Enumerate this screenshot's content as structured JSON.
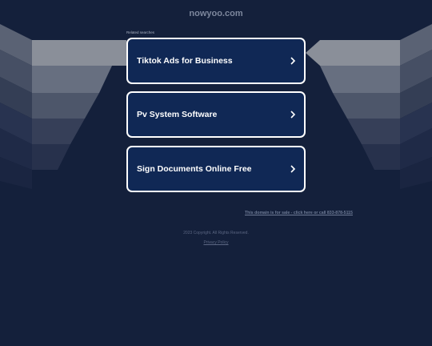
{
  "header": {
    "domain": "nowyoo.com"
  },
  "related": {
    "label": "Related searches",
    "items": [
      {
        "label": "Tiktok Ads for Business"
      },
      {
        "label": "Pv System Software"
      },
      {
        "label": "Sign Documents Online Free"
      }
    ]
  },
  "footer": {
    "for_sale": "This domain is for sale - click here or call 833-878-5115",
    "copyright": "2023 Copyright. All Rights Reserved.",
    "privacy": "Privacy Policy"
  },
  "colors": {
    "background": "#14203b",
    "box": "#102855",
    "box_border": "#ffffff",
    "text_muted": "#7d879d"
  },
  "icons": [
    "chevron-right-icon"
  ]
}
